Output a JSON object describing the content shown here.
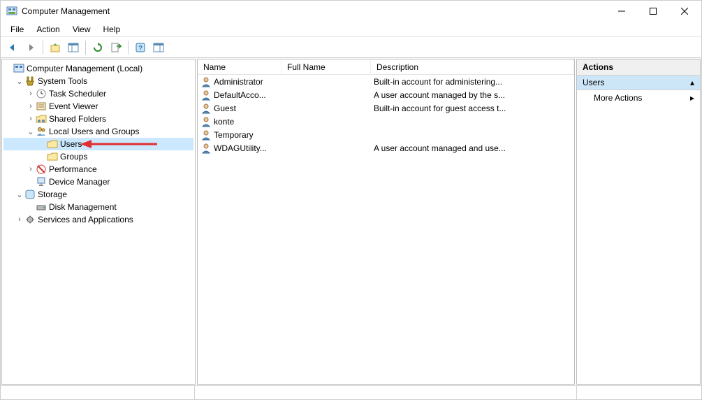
{
  "window": {
    "title": "Computer Management"
  },
  "menu": [
    "File",
    "Action",
    "View",
    "Help"
  ],
  "tree": {
    "root": {
      "label": "Computer Management (Local)"
    },
    "system_tools": {
      "label": "System Tools"
    },
    "task_scheduler": {
      "label": "Task Scheduler"
    },
    "event_viewer": {
      "label": "Event Viewer"
    },
    "shared_folders": {
      "label": "Shared Folders"
    },
    "local_users": {
      "label": "Local Users and Groups"
    },
    "users": {
      "label": "Users"
    },
    "groups": {
      "label": "Groups"
    },
    "performance": {
      "label": "Performance"
    },
    "device_manager": {
      "label": "Device Manager"
    },
    "storage": {
      "label": "Storage"
    },
    "disk_management": {
      "label": "Disk Management"
    },
    "services_apps": {
      "label": "Services and Applications"
    }
  },
  "columns": {
    "name": "Name",
    "full": "Full Name",
    "desc": "Description"
  },
  "users_list": [
    {
      "name": "Administrator",
      "full": "",
      "desc": "Built-in account for administering..."
    },
    {
      "name": "DefaultAcco...",
      "full": "",
      "desc": "A user account managed by the s..."
    },
    {
      "name": "Guest",
      "full": "",
      "desc": "Built-in account for guest access t..."
    },
    {
      "name": "konte",
      "full": "",
      "desc": ""
    },
    {
      "name": "Temporary",
      "full": "",
      "desc": ""
    },
    {
      "name": "WDAGUtility...",
      "full": "",
      "desc": "A user account managed and use..."
    }
  ],
  "actions": {
    "title": "Actions",
    "section": "Users",
    "more": "More Actions"
  }
}
